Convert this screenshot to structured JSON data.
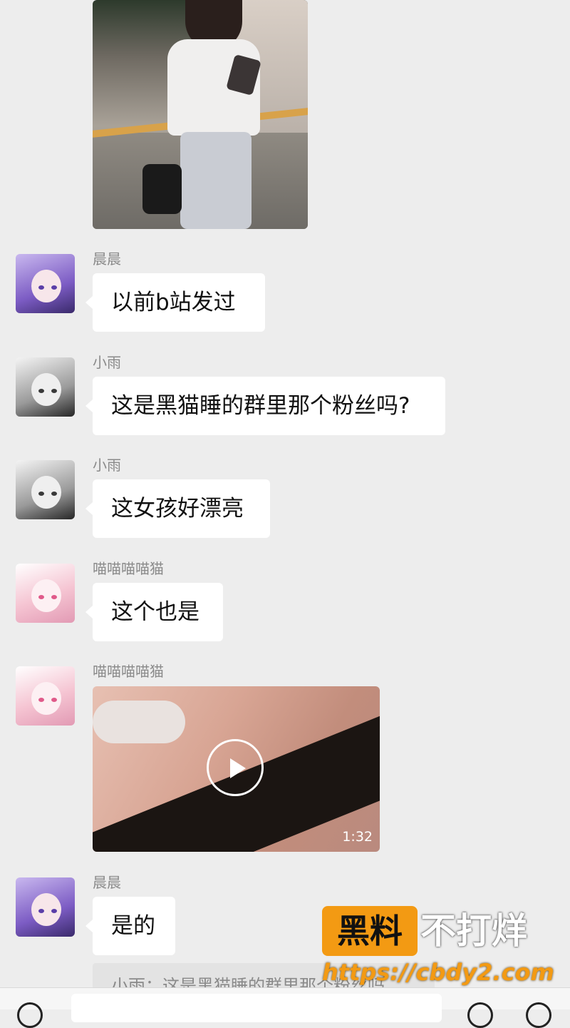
{
  "messages": [
    {
      "sender": "晨晨",
      "text": "以前b站发过"
    },
    {
      "sender": "小雨",
      "text": "这是黑猫睡的群里那个粉丝吗?"
    },
    {
      "sender": "小雨",
      "text": "这女孩好漂亮"
    },
    {
      "sender": "喵喵喵喵猫",
      "text": "这个也是"
    },
    {
      "sender": "喵喵喵喵猫",
      "video_duration": "1:32"
    },
    {
      "sender": "晨晨",
      "text": "是的"
    }
  ],
  "quote": {
    "text": "小雨：这是黑猫睡的群里那个粉丝吗"
  },
  "watermark": {
    "box": "黑料",
    "text": "不打烊",
    "url": "https://cbdy2.com"
  },
  "colors": {
    "background": "#ededed",
    "bubble": "#ffffff",
    "accent": "#f39a13"
  }
}
